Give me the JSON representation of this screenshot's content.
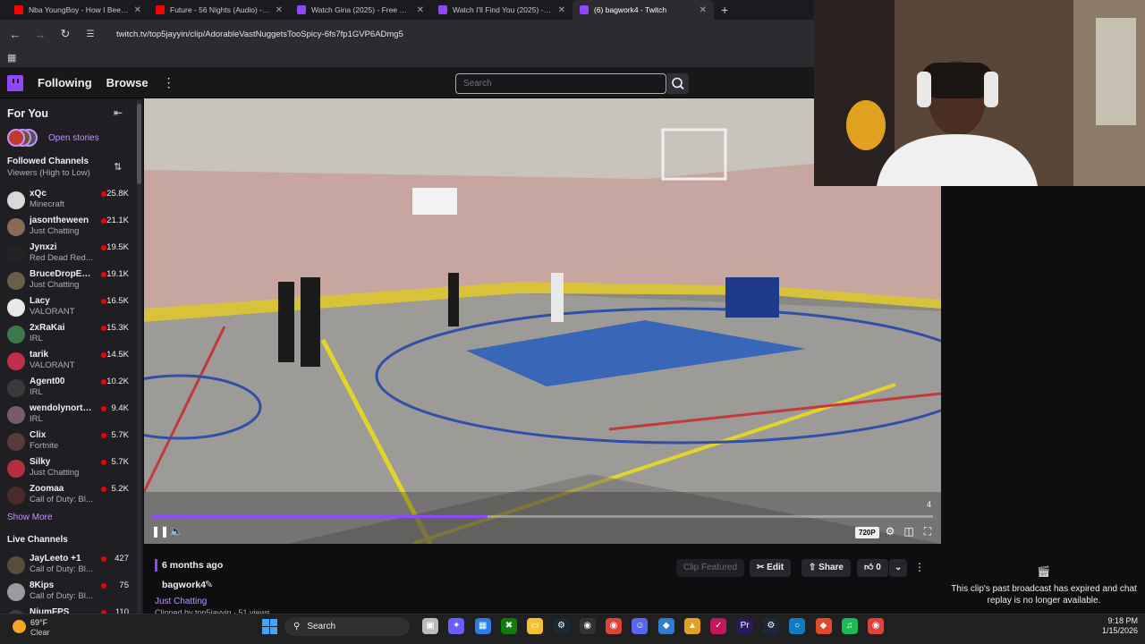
{
  "browser": {
    "tabs": [
      {
        "title": "Nba YoungBoy - How I Been - Y",
        "favicon_color": "#ff0000",
        "active": false
      },
      {
        "title": "Future - 56 Nights (Audio) - Yo",
        "favicon_color": "#ff0000",
        "active": false
      },
      {
        "title": "Watch Gina (2025) - Free Movie",
        "favicon_color": "#9147ff",
        "active": false
      },
      {
        "title": "Watch I'll Find You (2025) - Fre",
        "favicon_color": "#9147ff",
        "active": false
      },
      {
        "title": "(6) bagwork4 - Twitch",
        "favicon_color": "#9147ff",
        "active": true
      }
    ],
    "url": "twitch.tv/top5jayyin/clip/AdorableVastNuggetsTooSpicy-6fs7fp1GVP6ADmg5"
  },
  "nav": {
    "following": "Following",
    "browse": "Browse",
    "search_placeholder": "Search"
  },
  "sidebar": {
    "for_you": "For You",
    "open_stories": "Open stories",
    "followed_heading": "Followed Channels",
    "followed_sort": "Viewers (High to Low)",
    "followed": [
      {
        "name": "xQc",
        "game": "Minecraft",
        "viewers": "25.8K",
        "color": "#d9d9d9"
      },
      {
        "name": "jasontheween",
        "game": "Just Chatting",
        "viewers": "21.1K",
        "color": "#8a6a55"
      },
      {
        "name": "Jynxzi",
        "game": "Red Dead Red...",
        "viewers": "19.5K",
        "color": "#222"
      },
      {
        "name": "BruceDropEm...",
        "game": "Just Chatting",
        "viewers": "19.1K",
        "color": "#6b5d4a"
      },
      {
        "name": "Lacy",
        "game": "VALORANT",
        "viewers": "16.5K",
        "color": "#e8e8e8"
      },
      {
        "name": "2xRaKai",
        "game": "IRL",
        "viewers": "15.3K",
        "color": "#3a7a4a"
      },
      {
        "name": "tarik",
        "game": "VALORANT",
        "viewers": "14.5K",
        "color": "#c0304a"
      },
      {
        "name": "Agent00",
        "game": "IRL",
        "viewers": "10.2K",
        "color": "#3a3a3a"
      },
      {
        "name": "wendolynortizz",
        "game": "IRL",
        "viewers": "9.4K",
        "color": "#7a5a6a"
      },
      {
        "name": "Clix",
        "game": "Fortnite",
        "viewers": "5.7K",
        "color": "#5a3a3a"
      },
      {
        "name": "Silky",
        "game": "Just Chatting",
        "viewers": "5.7K",
        "color": "#b03040"
      },
      {
        "name": "Zoomaa",
        "game": "Call of Duty: Bl...",
        "viewers": "5.2K",
        "color": "#4a2a2a"
      }
    ],
    "show_more": "Show More",
    "live_heading": "Live Channels",
    "live": [
      {
        "name": "JayLeeto +1",
        "game": "Call of Duty: Bl...",
        "viewers": "427",
        "color": "#5a4a3a"
      },
      {
        "name": "8Kips",
        "game": "Call of Duty: Bl...",
        "viewers": "75",
        "color": "#9a9aa0"
      },
      {
        "name": "NiumFPS",
        "game": "",
        "viewers": "110",
        "color": "#3a3a5a"
      }
    ]
  },
  "player": {
    "progress": 0.43,
    "overlay_counter": "4",
    "quality": "720P"
  },
  "clip": {
    "age": "6 months ago",
    "channel": "bagwork4",
    "category": "Just Chatting",
    "clipped_by": "Clipped by top5jayyin · 51 views",
    "featured_label": "Clip Featured",
    "edit_label": "Edit",
    "share_label": "Share",
    "likes": "0"
  },
  "chat": {
    "message": "This clip's past broadcast has expired and chat replay is no longer available."
  },
  "taskbar": {
    "temp": "69°F",
    "condition": "Clear",
    "search_label": "Search",
    "time": "9:18 PM",
    "date": "1/15/2026"
  }
}
